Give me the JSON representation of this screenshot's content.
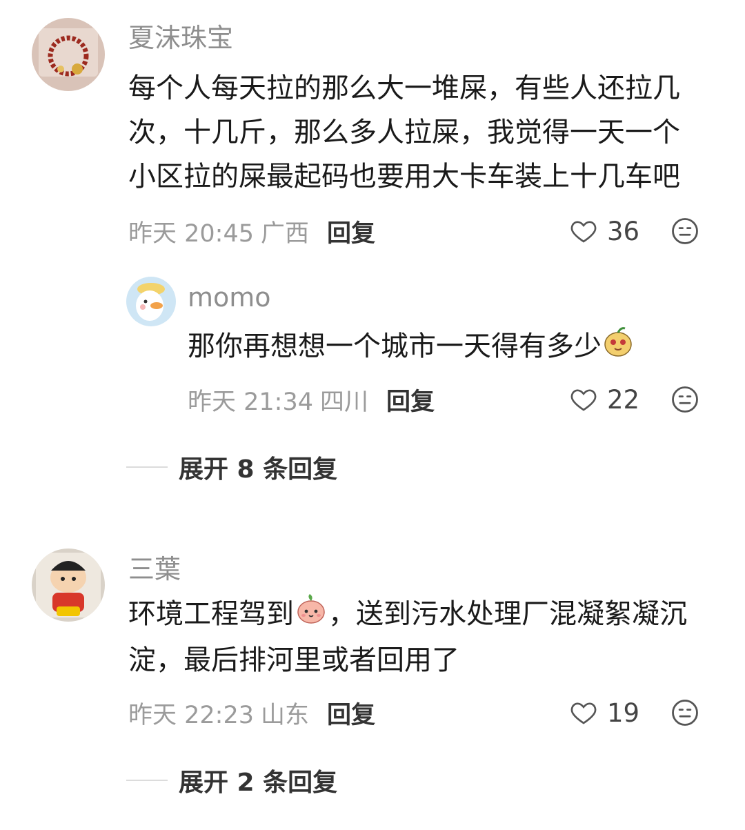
{
  "comments": [
    {
      "username": "夏沫珠宝",
      "text": "每个人每天拉的那么大一堆屎，有些人还拉几次，十几斤，那么多人拉屎，我觉得一天一个小区拉的屎最起码也要用大卡车装上十几车吧",
      "lines": [
        "每个人每天拉的那么大一堆屎，有些人还拉几",
        "次，十几斤，那么多人拉屎，我觉得一天一个",
        "小区拉的屎最起码也要用大卡车装上十几车吧"
      ],
      "time": "昨天 20:45",
      "location": "广西",
      "reply_label": "回复",
      "likes": "36",
      "reply": {
        "username": "momo",
        "text": "那你再想想一个城市一天得有多少",
        "time": "昨天 21:34",
        "location": "四川",
        "reply_label": "回复",
        "likes": "22"
      },
      "expand_label": "展开 8 条回复"
    },
    {
      "username": "三葉",
      "text_part1": "环境工程驾到",
      "text_part2": "，送到污水处理厂混凝絮凝沉",
      "text_line2": "淀，最后排河里或者回用了",
      "time": "昨天 22:23",
      "location": "山东",
      "reply_label": "回复",
      "likes": "19",
      "expand_label": "展开 2 条回复"
    }
  ],
  "icons": [
    "heart-icon",
    "emoji-face-icon",
    "avatar-bracelet",
    "avatar-duck",
    "avatar-crayon-shin"
  ]
}
